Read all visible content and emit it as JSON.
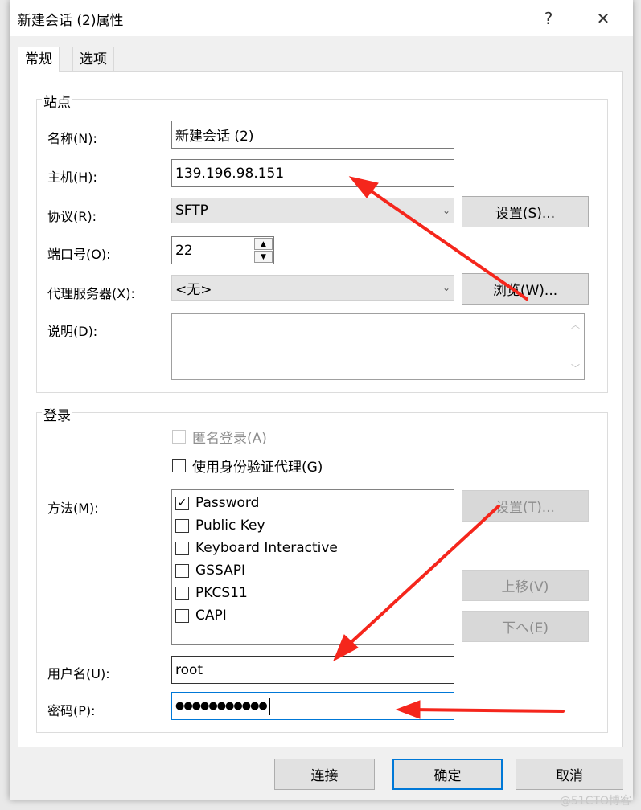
{
  "window": {
    "title": "新建会话 (2)属性",
    "help": "?",
    "close": "✕"
  },
  "tabs": [
    {
      "label": "常规"
    },
    {
      "label": "选项"
    }
  ],
  "site": {
    "group": "站点",
    "name_label": "名称(N):",
    "name_value": "新建会话 (2)",
    "host_label": "主机(H):",
    "host_value": "139.196.98.151",
    "protocol_label": "协议(R):",
    "protocol_value": "SFTP",
    "settings_button": "设置(S)...",
    "port_label": "端口号(O):",
    "port_value": "22",
    "proxy_label": "代理服务器(X):",
    "proxy_value": "<无>",
    "browse_button": "浏览(W)...",
    "desc_label": "说明(D):",
    "desc_value": ""
  },
  "login": {
    "group": "登录",
    "anonymous": {
      "label": "匿名登录(A)",
      "checked": false,
      "disabled": true
    },
    "agent": {
      "label": "使用身份验证代理(G)",
      "checked": false
    },
    "method_label": "方法(M):",
    "methods": [
      {
        "label": "Password",
        "checked": true
      },
      {
        "label": "Public Key",
        "checked": false
      },
      {
        "label": "Keyboard Interactive",
        "checked": false
      },
      {
        "label": "GSSAPI",
        "checked": false
      },
      {
        "label": "PKCS11",
        "checked": false
      },
      {
        "label": "CAPI",
        "checked": false
      }
    ],
    "method_settings_button": "设置(T)...",
    "move_up_button": "上移(V)",
    "move_down_button": "下へ(E)",
    "username_label": "用户名(U):",
    "username_value": "root",
    "password_label": "密码(P):",
    "password_value": "●●●●●●●●●●●"
  },
  "footer": {
    "connect": "连接",
    "ok": "确定",
    "cancel": "取消"
  },
  "watermark": "@51CTO博客",
  "colors": {
    "annotation_arrow": "#f5261c",
    "focus": "#0078d7"
  }
}
